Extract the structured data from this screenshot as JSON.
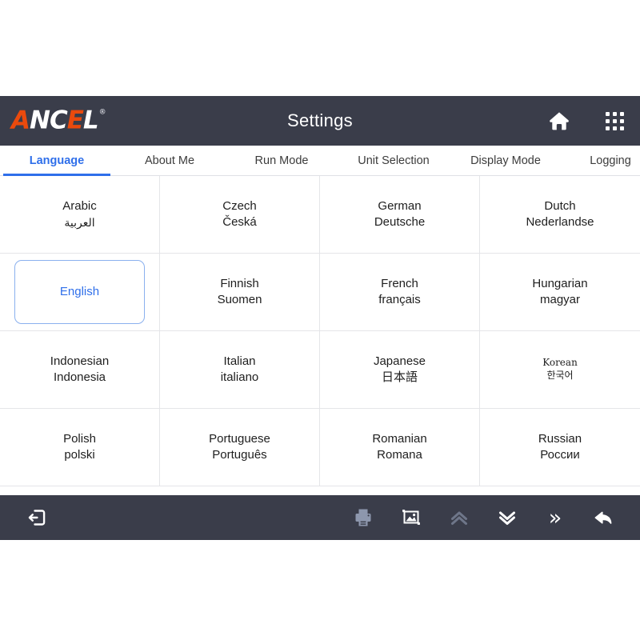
{
  "header": {
    "logo": {
      "part_a": "A",
      "part_nc": "NC",
      "part_e": "E",
      "part_l": "L",
      "registered": "®",
      "accent_color": "#ea4a0d"
    },
    "title": "Settings",
    "icons": [
      {
        "name": "home-icon",
        "label": "Home"
      },
      {
        "name": "apps-grid-icon",
        "label": "Apps"
      }
    ],
    "background_color": "#3a3d4a"
  },
  "tabs": {
    "active_index": 0,
    "active_color": "#2f6fea",
    "items": [
      {
        "label": "Language"
      },
      {
        "label": "About Me"
      },
      {
        "label": "Run Mode"
      },
      {
        "label": "Unit Selection"
      },
      {
        "label": "Display Mode"
      },
      {
        "label": "Logging"
      }
    ],
    "more_label": "»"
  },
  "language_grid": {
    "selected": "English",
    "columns": 4,
    "cells": [
      {
        "name": "Arabic",
        "native": "العربية",
        "script": "ar"
      },
      {
        "name": "Czech",
        "native": "Česká",
        "script": "latin"
      },
      {
        "name": "German",
        "native": "Deutsche",
        "script": "latin"
      },
      {
        "name": "Dutch",
        "native": "Nederlandse",
        "script": "latin"
      },
      {
        "name": "English",
        "native": "",
        "script": "latin"
      },
      {
        "name": "Finnish",
        "native": "Suomen",
        "script": "latin"
      },
      {
        "name": "French",
        "native": "français",
        "script": "latin"
      },
      {
        "name": "Hungarian",
        "native": "magyar",
        "script": "latin"
      },
      {
        "name": "Indonesian",
        "native": "Indonesia",
        "script": "latin"
      },
      {
        "name": "Italian",
        "native": "italiano",
        "script": "latin"
      },
      {
        "name": "Japanese",
        "native": "日本語",
        "script": "jp"
      },
      {
        "name": "Korean",
        "native": "한국어",
        "script": "ko"
      },
      {
        "name": "Polish",
        "native": "polski",
        "script": "latin"
      },
      {
        "name": "Portuguese",
        "native": "Português",
        "script": "latin"
      },
      {
        "name": "Romanian",
        "native": "Romana",
        "script": "latin"
      },
      {
        "name": "Russian",
        "native": "России",
        "script": "latin"
      }
    ]
  },
  "toolbar": {
    "background_color": "#3a3d4a",
    "buttons": [
      {
        "name": "exit-icon",
        "label": "Exit",
        "enabled": true
      },
      {
        "name": "print-icon",
        "label": "Print",
        "enabled": false
      },
      {
        "name": "screenshot-icon",
        "label": "Screenshot",
        "enabled": true
      },
      {
        "name": "page-up-icon",
        "label": "Page Up",
        "enabled": false
      },
      {
        "name": "page-down-icon",
        "label": "Page Down",
        "enabled": true
      },
      {
        "name": "fast-forward-icon",
        "label": "Next",
        "enabled": true,
        "glyph": "»"
      },
      {
        "name": "back-arrow-icon",
        "label": "Back",
        "enabled": true
      }
    ]
  }
}
